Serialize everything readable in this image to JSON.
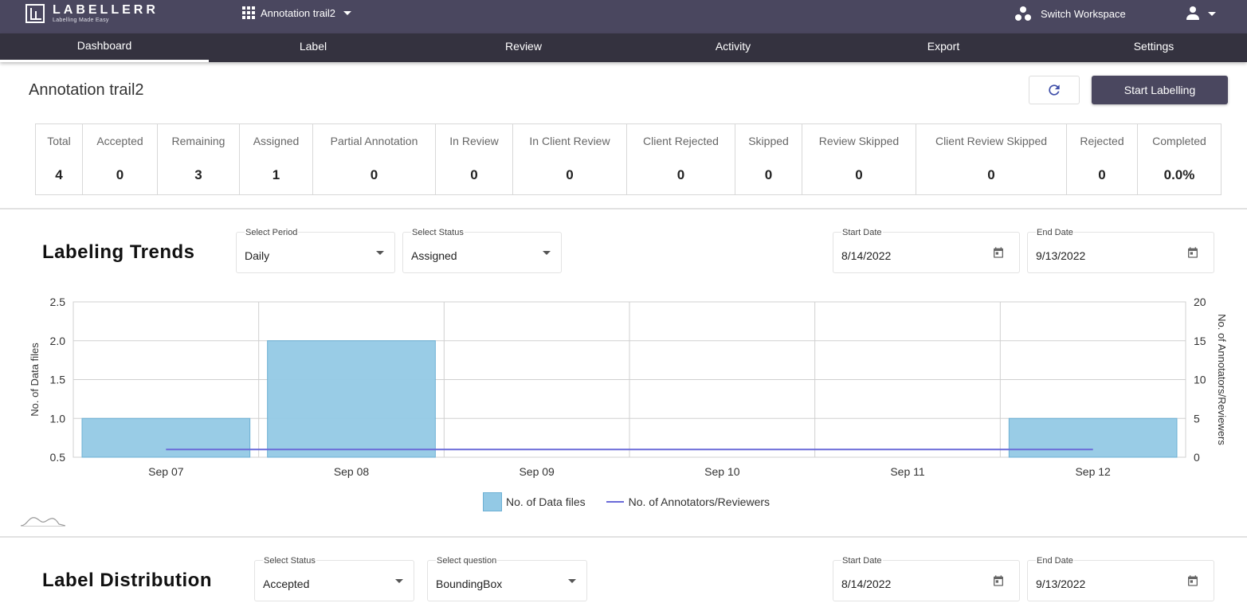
{
  "app": {
    "brand": "LABELLERR",
    "tagline": "Labelling Made Easy"
  },
  "header": {
    "project_name": "Annotation trail2",
    "switch_workspace": "Switch Workspace"
  },
  "nav": {
    "tabs": [
      "Dashboard",
      "Label",
      "Review",
      "Activity",
      "Export",
      "Settings"
    ],
    "active": "Dashboard"
  },
  "page": {
    "title": "Annotation trail2",
    "start_button": "Start Labelling"
  },
  "stats": [
    {
      "label": "Total",
      "value": "4"
    },
    {
      "label": "Accepted",
      "value": "0"
    },
    {
      "label": "Remaining",
      "value": "3"
    },
    {
      "label": "Assigned",
      "value": "1"
    },
    {
      "label": "Partial Annotation",
      "value": "0"
    },
    {
      "label": "In Review",
      "value": "0"
    },
    {
      "label": "In Client Review",
      "value": "0"
    },
    {
      "label": "Client Rejected",
      "value": "0"
    },
    {
      "label": "Skipped",
      "value": "0"
    },
    {
      "label": "Review Skipped",
      "value": "0"
    },
    {
      "label": "Client Review Skipped",
      "value": "0"
    },
    {
      "label": "Rejected",
      "value": "0"
    },
    {
      "label": "Completed",
      "value": "0.0%"
    }
  ],
  "trends": {
    "title": "Labeling Trends",
    "period": {
      "label": "Select Period",
      "value": "Daily"
    },
    "status": {
      "label": "Select Status",
      "value": "Assigned"
    },
    "start_date": {
      "label": "Start Date",
      "value": "8/14/2022"
    },
    "end_date": {
      "label": "End Date",
      "value": "9/13/2022"
    }
  },
  "distribution": {
    "title": "Label Distribution",
    "status": {
      "label": "Select Status",
      "value": "Accepted"
    },
    "question": {
      "label": "Select question",
      "value": "BoundingBox"
    },
    "start_date": {
      "label": "Start Date",
      "value": "8/14/2022"
    },
    "end_date": {
      "label": "End Date",
      "value": "9/13/2022"
    }
  },
  "chart_data": {
    "type": "bar",
    "categories": [
      "Sep 07",
      "Sep 08",
      "Sep 09",
      "Sep 10",
      "Sep 11",
      "Sep 12"
    ],
    "series": [
      {
        "name": "No. of Data files",
        "type": "bar",
        "axis": "left",
        "values": [
          1,
          2,
          0,
          0,
          0,
          1
        ],
        "color": "#93c9e5"
      },
      {
        "name": "No. of Annotators/Reviewers",
        "type": "line",
        "axis": "right",
        "values": [
          1,
          1,
          1,
          1,
          1,
          1
        ],
        "color": "#6a6ad8"
      }
    ],
    "ylabel": "No. of Data files",
    "y2label": "No. of Annotators/Reviewers",
    "ylim": [
      0.5,
      2.5
    ],
    "y2lim": [
      0,
      20
    ],
    "yticks": [
      "2.5",
      "2.0",
      "1.5",
      "1.0",
      "0.5"
    ],
    "y2ticks": [
      "20",
      "15",
      "10",
      "5",
      "0"
    ],
    "grid": true,
    "legend_position": "bottom"
  }
}
